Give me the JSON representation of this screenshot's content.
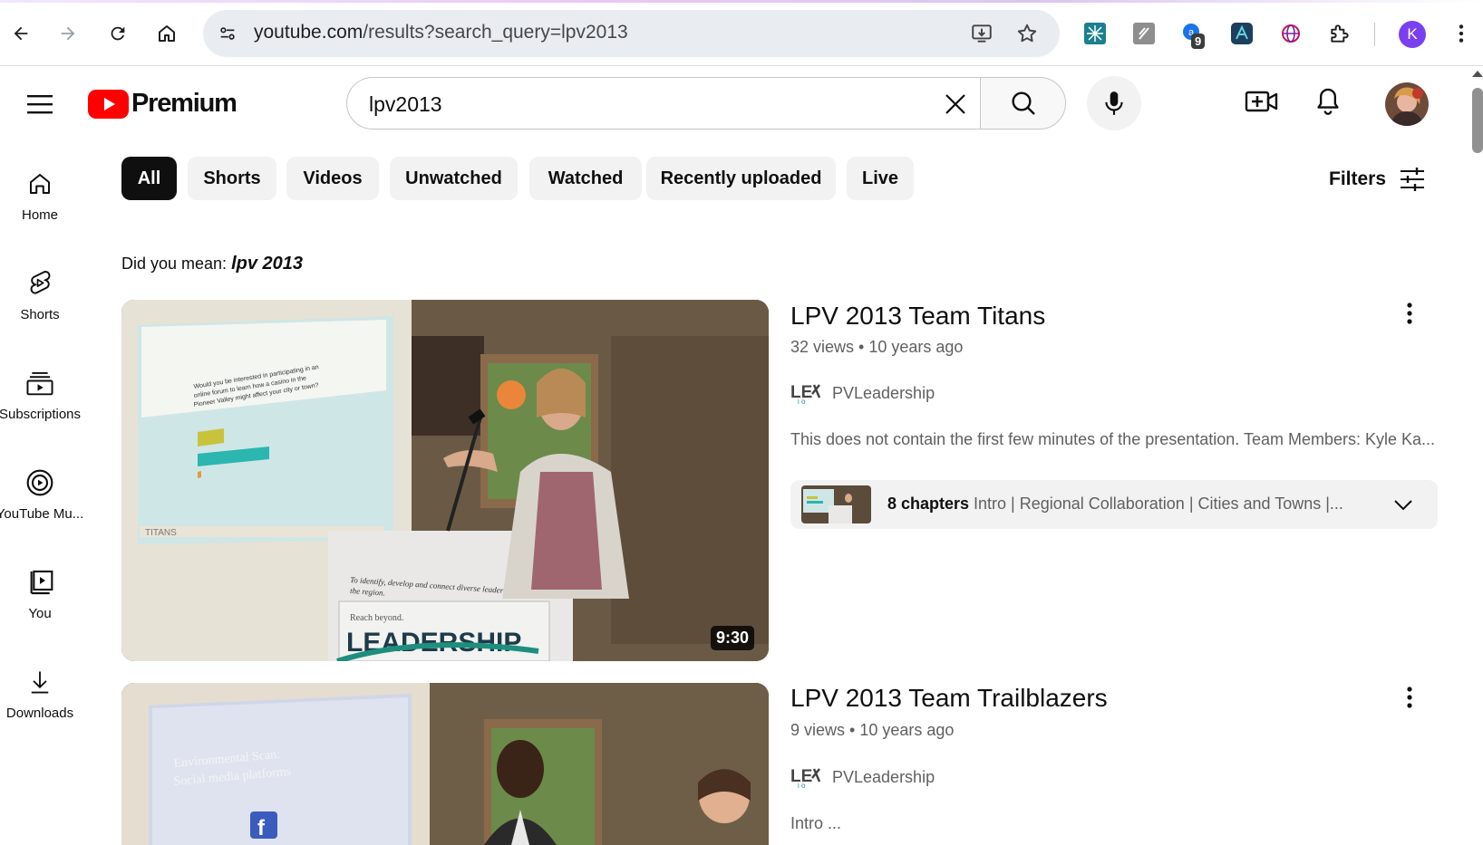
{
  "browser": {
    "url_host": "youtube.com",
    "url_path": "/results?search_query=lpv2013",
    "extension_badge": "9",
    "profile_initial": "K"
  },
  "header": {
    "logo_text": "Premium",
    "search_value": "lpv2013"
  },
  "sidebar": {
    "items": [
      {
        "label": "Home",
        "icon": "home-icon"
      },
      {
        "label": "Shorts",
        "icon": "shorts-icon"
      },
      {
        "label": "Subscriptions",
        "icon": "subscriptions-icon"
      },
      {
        "label": "YouTube Mu...",
        "icon": "youtube-music-icon"
      },
      {
        "label": "You",
        "icon": "you-icon"
      },
      {
        "label": "Downloads",
        "icon": "download-icon"
      }
    ]
  },
  "chips": [
    "All",
    "Shorts",
    "Videos",
    "Unwatched",
    "Watched",
    "Recently uploaded",
    "Live"
  ],
  "filters_label": "Filters",
  "did_you_mean": {
    "prefix": "Did you mean:",
    "suggestion": "lpv 2013"
  },
  "results": [
    {
      "title": "LPV 2013 Team Titans",
      "views": "32 views",
      "age": "10 years ago",
      "channel": "PVLeadership",
      "description": "This does not contain the first few minutes of the presentation. Team Members: Kyle Ka...",
      "duration": "9:30",
      "chapters_count": "8 chapters",
      "chapters_list": "Intro | Regional Collaboration | Cities and Towns |..."
    },
    {
      "title": "LPV 2013 Team Trailblazers",
      "views": "9 views",
      "age": "10 years ago",
      "channel": "PVLeadership",
      "description": "Intro ..."
    }
  ],
  "colors": {
    "brand_red": "#ff0000",
    "chip_active_bg": "#0f0f0f",
    "chip_bg": "#f2f2f2",
    "meta_text": "#606060"
  }
}
